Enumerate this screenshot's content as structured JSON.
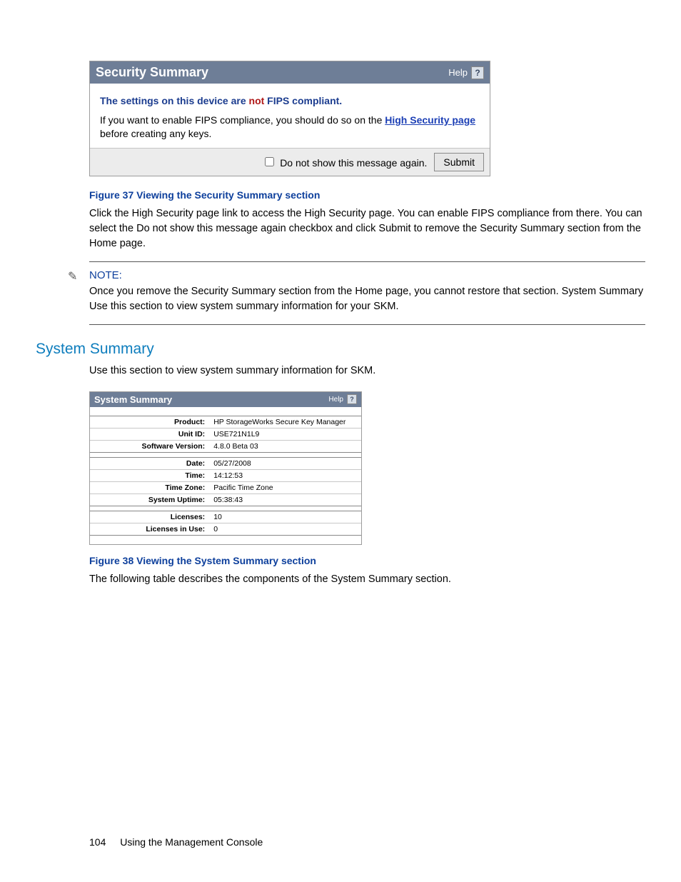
{
  "panel1": {
    "title": "Security Summary",
    "help_label": "Help",
    "fips_prefix": "The settings on this device are ",
    "fips_not": "not",
    "fips_suffix": " FIPS compliant.",
    "body_1": "If you want to enable FIPS compliance, you should do so on the ",
    "link_text": "High Security page",
    "body_2": " before creating any keys.",
    "checkbox_label": "Do not show this message again.",
    "submit_label": "Submit"
  },
  "fig37": {
    "caption": "Figure 37 Viewing the Security Summary section",
    "text": "Click the High Security page link to access the High Security page. You can enable FIPS compliance from there. You can select the Do not show this message again checkbox and click Submit to remove the Security Summary section from the Home page."
  },
  "note": {
    "label": "NOTE:",
    "text": "Once you remove the Security Summary section from the Home page, you cannot restore that section. System Summary Use this section to view system summary information for your SKM."
  },
  "system_summary": {
    "heading": "System Summary",
    "intro": "Use this section to view system summary information for SKM.",
    "panel_title": "System Summary",
    "group1": [
      {
        "k": "Product:",
        "v": "HP StorageWorks Secure Key Manager"
      },
      {
        "k": "Unit ID:",
        "v": "USE721N1L9"
      },
      {
        "k": "Software Version:",
        "v": "4.8.0 Beta 03"
      }
    ],
    "group2": [
      {
        "k": "Date:",
        "v": "05/27/2008"
      },
      {
        "k": "Time:",
        "v": "14:12:53"
      },
      {
        "k": "Time Zone:",
        "v": "Pacific Time Zone"
      },
      {
        "k": "System Uptime:",
        "v": "05:38:43"
      }
    ],
    "group3": [
      {
        "k": "Licenses:",
        "v": "10"
      },
      {
        "k": "Licenses in Use:",
        "v": "0"
      }
    ]
  },
  "fig38": {
    "caption": "Figure 38 Viewing the System Summary section",
    "text": "The following table describes the components of the System Summary section."
  },
  "footer": {
    "page_num": "104",
    "chapter": "Using the Management Console"
  }
}
